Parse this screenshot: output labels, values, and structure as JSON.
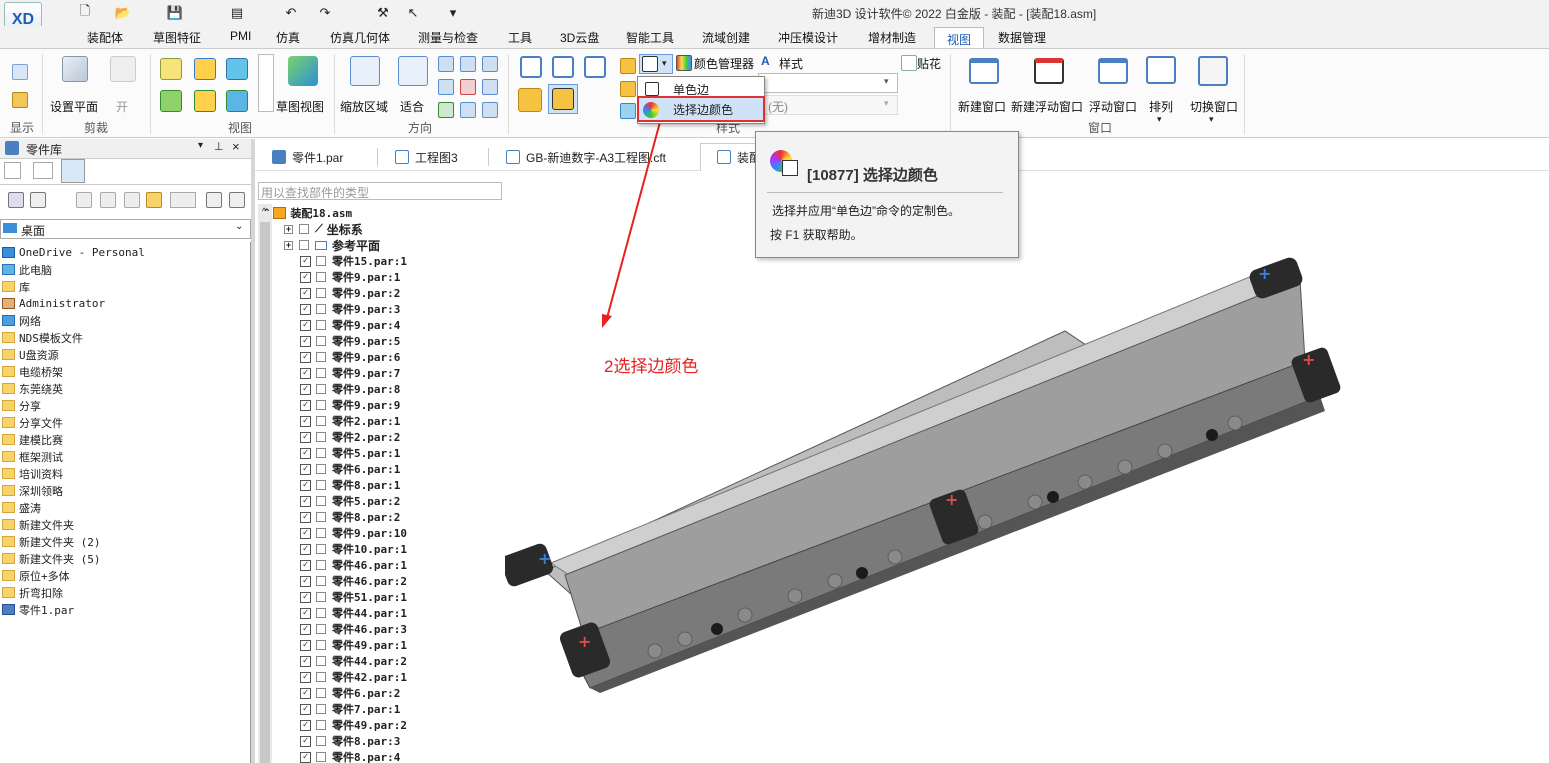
{
  "title": "新迪3D 设计软件© 2022 白金版 - 装配 - [装配18.asm]",
  "app_logo": "XD",
  "tabs": [
    "装配体",
    "草图特征",
    "PMI",
    "仿真",
    "仿真几何体",
    "测量与检查",
    "工具",
    "3D云盘",
    "智能工具",
    "流域创建",
    "冲压模设计",
    "增材制造",
    "视图",
    "数据管理"
  ],
  "active_tab": "视图",
  "ribbon": {
    "groups": [
      "显示",
      "剪裁",
      "视图",
      "方向",
      "样式",
      "窗口"
    ],
    "set_plane": "设置平面",
    "open_label": "开",
    "sketch_view": "草图视图",
    "zoom_area": "缩放区域",
    "fit": "适合",
    "color_manager": "颜色管理器",
    "style": "样式",
    "decal": "贴花",
    "none_value": "(无)",
    "new_window": "新建窗口",
    "new_float_window": "新建浮动窗口",
    "float_window": "浮动窗口",
    "arrange": "排列",
    "switch_window": "切换窗口"
  },
  "dropdown": {
    "item1": "单色边",
    "item2": "选择边颜色"
  },
  "tooltip": {
    "title": "[10877] 选择边颜色",
    "desc": "选择并应用“单色边”命令的定制色。",
    "help": "按 F1 获取帮助。"
  },
  "annotation": "2选择边颜色",
  "left_panel": {
    "title": "零件库",
    "location": "桌面",
    "items": [
      "OneDrive - Personal",
      "此电脑",
      "库",
      "Administrator",
      "网络",
      "NDS模板文件",
      "U盘资源",
      "电缆桥架",
      "东莞绕英",
      "分享",
      "分享文件",
      "建模比赛",
      "框架测试",
      "培训资料",
      "深圳领略",
      "盛涛",
      "新建文件夹",
      "新建文件夹 (2)",
      "新建文件夹 (5)",
      "原位+多体",
      "折弯扣除",
      "零件1.par"
    ]
  },
  "doc_tabs": [
    "零件1.par",
    "工程图3",
    "GB-新迪数字-A3工程图.cft",
    "装配"
  ],
  "tree": {
    "search_placeholder": "用以查找部件的类型",
    "root": "装配18.asm",
    "coord": "坐标系",
    "ref_planes": "参考平面",
    "parts": [
      "零件15.par:1",
      "零件9.par:1",
      "零件9.par:2",
      "零件9.par:3",
      "零件9.par:4",
      "零件9.par:5",
      "零件9.par:6",
      "零件9.par:7",
      "零件9.par:8",
      "零件9.par:9",
      "零件2.par:1",
      "零件2.par:2",
      "零件5.par:1",
      "零件6.par:1",
      "零件8.par:1",
      "零件5.par:2",
      "零件8.par:2",
      "零件9.par:10",
      "零件10.par:1",
      "零件46.par:1",
      "零件46.par:2",
      "零件51.par:1",
      "零件44.par:1",
      "零件46.par:3",
      "零件49.par:1",
      "零件44.par:2",
      "零件42.par:1",
      "零件6.par:2",
      "零件7.par:1",
      "零件49.par:2",
      "零件8.par:3",
      "零件8.par:4"
    ]
  }
}
